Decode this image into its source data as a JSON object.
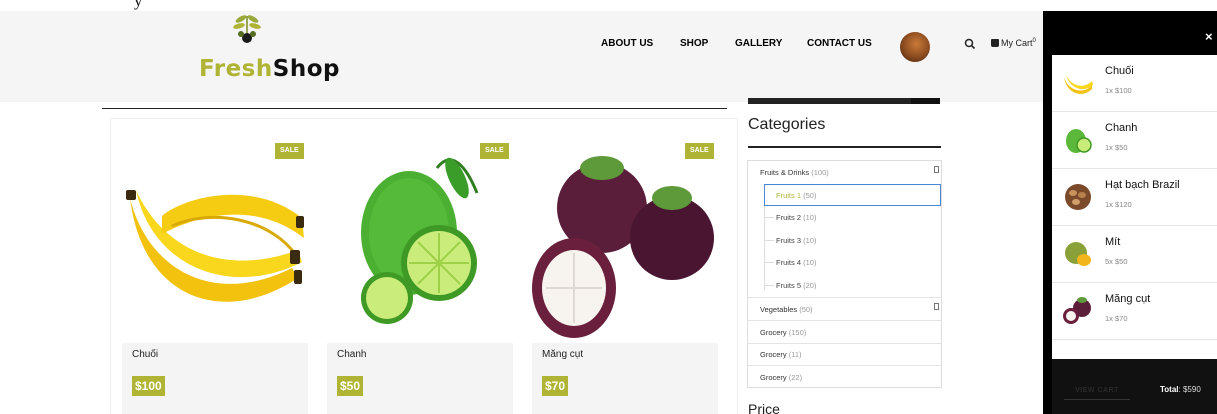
{
  "top_strip": {
    "text": "y"
  },
  "brand": {
    "part1": "Fresh",
    "part2": "Shop"
  },
  "nav": {
    "about": "ABOUT US",
    "shop": "SHOP",
    "gallery": "GALLERY",
    "contact": "CONTACT US"
  },
  "cart_link": {
    "label": "My Cart",
    "badge": "0"
  },
  "products": [
    {
      "badge": "SALE",
      "name": "Chuối",
      "price": "$100"
    },
    {
      "badge": "SALE",
      "name": "Chanh",
      "price": "$50"
    },
    {
      "badge": "SALE",
      "name": "Măng cụt",
      "price": "$70"
    }
  ],
  "sidebar": {
    "categories_title": "Categories",
    "price_title": "Price",
    "categories": [
      {
        "label": "Fruits & Drinks",
        "count": "(100)"
      },
      {
        "label": "Vegetables",
        "count": "(50)"
      },
      {
        "label": "Grocery",
        "count": "(150)"
      },
      {
        "label": "Grocery",
        "count": "(11)"
      },
      {
        "label": "Grocery",
        "count": "(22)"
      }
    ],
    "subcategories": [
      {
        "label": "Fruits 1",
        "count": "(50)"
      },
      {
        "label": "Fruits 2",
        "count": "(10)"
      },
      {
        "label": "Fruits 3",
        "count": "(10)"
      },
      {
        "label": "Fruits 4",
        "count": "(10)"
      },
      {
        "label": "Fruits 5",
        "count": "(20)"
      }
    ]
  },
  "cart_panel": {
    "close": "×",
    "items": [
      {
        "name": "Chuối",
        "qty": "1x $100",
        "icon": "banana-icon"
      },
      {
        "name": "Chanh",
        "qty": "1x $50",
        "icon": "lime-icon"
      },
      {
        "name": "Hạt bạch Brazil",
        "qty": "1x $120",
        "icon": "brazil-nut-icon"
      },
      {
        "name": "Mít",
        "qty": "5x $50",
        "icon": "jackfruit-icon"
      },
      {
        "name": "Măng cụt",
        "qty": "1x $70",
        "icon": "mangosteen-icon"
      }
    ],
    "view_cart": "VIEW CART",
    "total_label": "Total",
    "total_value": "$590"
  },
  "colors": {
    "accent": "#b0b435",
    "cart_panel_bg": "#000000",
    "header_bg": "#f5f5f5",
    "active_border": "#4a86d8"
  }
}
